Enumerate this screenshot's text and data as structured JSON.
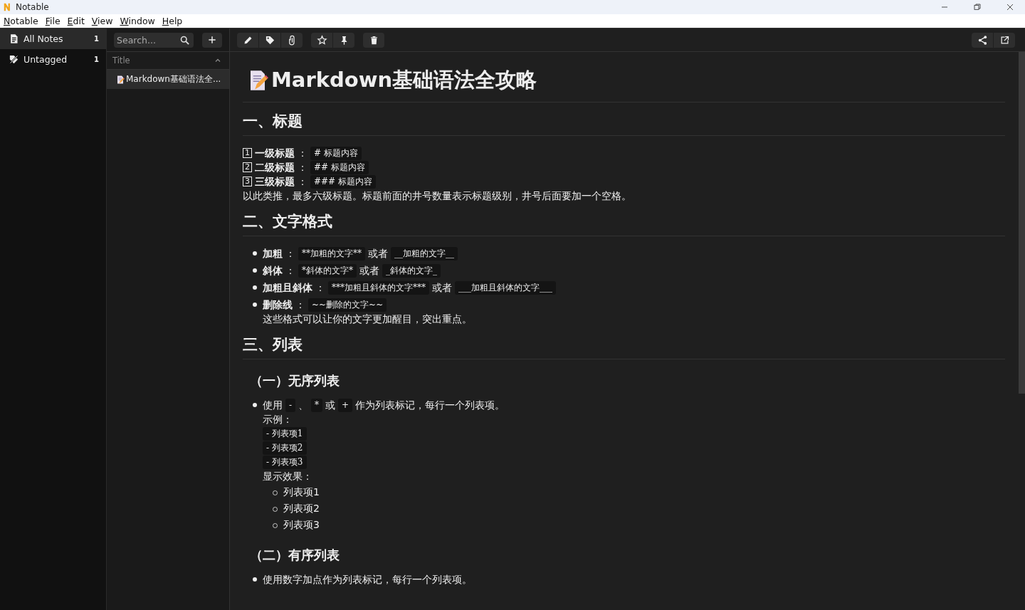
{
  "window": {
    "title": "Notable"
  },
  "menu": [
    "Notable",
    "File",
    "Edit",
    "View",
    "Window",
    "Help"
  ],
  "sidebar": {
    "items": [
      {
        "kind": "notes",
        "label": "All Notes",
        "count": "1",
        "selected": true
      },
      {
        "kind": "untagged",
        "label": "Untagged",
        "count": "1",
        "selected": false
      }
    ]
  },
  "search": {
    "placeholder": "Search..."
  },
  "notes_list": {
    "header": "Title",
    "items": [
      {
        "title": "Markdown基础语法全...",
        "selected": true
      }
    ]
  },
  "document": {
    "title": "Markdown基础语法全攻略",
    "blocks": [
      {
        "kind": "h2",
        "text": "一、标题"
      },
      {
        "kind": "line",
        "runs": [
          {
            "kind": "key",
            "text": "1"
          },
          {
            "kind": "bold",
            "text": "一级标题"
          },
          {
            "kind": "text",
            "text": "："
          },
          {
            "kind": "code",
            "text": "# 标题内容"
          }
        ]
      },
      {
        "kind": "line",
        "runs": [
          {
            "kind": "key",
            "text": "2"
          },
          {
            "kind": "bold",
            "text": "二级标题"
          },
          {
            "kind": "text",
            "text": "："
          },
          {
            "kind": "code",
            "text": "## 标题内容"
          }
        ]
      },
      {
        "kind": "line",
        "runs": [
          {
            "kind": "key",
            "text": "3"
          },
          {
            "kind": "bold",
            "text": "三级标题"
          },
          {
            "kind": "text",
            "text": "："
          },
          {
            "kind": "code",
            "text": "### 标题内容"
          }
        ]
      },
      {
        "kind": "line",
        "runs": [
          {
            "kind": "text",
            "text": "以此类推，最多六级标题。标题前面的井号数量表示标题级别，井号后面要加一个空格。"
          }
        ]
      },
      {
        "kind": "h2",
        "text": "二、文字格式"
      },
      {
        "kind": "list",
        "items": [
          {
            "lines": [
              [
                {
                  "kind": "bold",
                  "text": "加粗"
                },
                {
                  "kind": "text",
                  "text": "："
                },
                {
                  "kind": "code",
                  "text": "**加粗的文字**"
                },
                {
                  "kind": "text",
                  "text": "或者"
                },
                {
                  "kind": "code",
                  "text": "__加粗的文字__"
                }
              ]
            ]
          },
          {
            "lines": [
              [
                {
                  "kind": "bold",
                  "text": "斜体"
                },
                {
                  "kind": "text",
                  "text": "："
                },
                {
                  "kind": "code",
                  "text": "*斜体的文字*"
                },
                {
                  "kind": "text",
                  "text": "或者"
                },
                {
                  "kind": "code",
                  "text": "_斜体的文字_"
                }
              ]
            ]
          },
          {
            "lines": [
              [
                {
                  "kind": "bold",
                  "text": "加粗且斜体"
                },
                {
                  "kind": "text",
                  "text": "："
                },
                {
                  "kind": "code",
                  "text": "***加粗且斜体的文字***"
                },
                {
                  "kind": "text",
                  "text": "或者"
                },
                {
                  "kind": "code",
                  "text": "___加粗且斜体的文字___"
                }
              ]
            ]
          },
          {
            "lines": [
              [
                {
                  "kind": "bold",
                  "text": "删除线"
                },
                {
                  "kind": "text",
                  "text": "："
                },
                {
                  "kind": "code",
                  "text": "~~删除的文字~~"
                }
              ],
              [
                {
                  "kind": "text",
                  "text": "这些格式可以让你的文字更加醒目，突出重点。"
                }
              ]
            ]
          }
        ]
      },
      {
        "kind": "h2",
        "text": "三、列表"
      },
      {
        "kind": "h3",
        "text": "（一）无序列表"
      },
      {
        "kind": "list",
        "items": [
          {
            "lines": [
              [
                {
                  "kind": "text",
                  "text": "使用"
                },
                {
                  "kind": "code",
                  "text": "-"
                },
                {
                  "kind": "text",
                  "text": "、"
                },
                {
                  "kind": "code",
                  "text": "*"
                },
                {
                  "kind": "text",
                  "text": "或"
                },
                {
                  "kind": "code",
                  "text": "+"
                },
                {
                  "kind": "text",
                  "text": "作为列表标记，每行一个列表项。"
                }
              ],
              [
                {
                  "kind": "text",
                  "text": "示例："
                }
              ],
              [
                {
                  "kind": "code",
                  "text": "- 列表项1"
                }
              ],
              [
                {
                  "kind": "code",
                  "text": "- 列表项2"
                }
              ],
              [
                {
                  "kind": "code",
                  "text": "- 列表项3"
                }
              ],
              [
                {
                  "kind": "text",
                  "text": "显示效果："
                }
              ]
            ],
            "children": [
              {
                "lines": [
                  [
                    {
                      "kind": "text",
                      "text": "列表项1"
                    }
                  ]
                ]
              },
              {
                "lines": [
                  [
                    {
                      "kind": "text",
                      "text": "列表项2"
                    }
                  ]
                ]
              },
              {
                "lines": [
                  [
                    {
                      "kind": "text",
                      "text": "列表项3"
                    }
                  ]
                ]
              }
            ]
          }
        ]
      },
      {
        "kind": "h3",
        "text": "（二）有序列表"
      },
      {
        "kind": "list",
        "items": [
          {
            "lines": [
              [
                {
                  "kind": "text",
                  "text": "使用数字加点作为列表标记，每行一个列表项。"
                }
              ]
            ]
          }
        ]
      }
    ]
  }
}
